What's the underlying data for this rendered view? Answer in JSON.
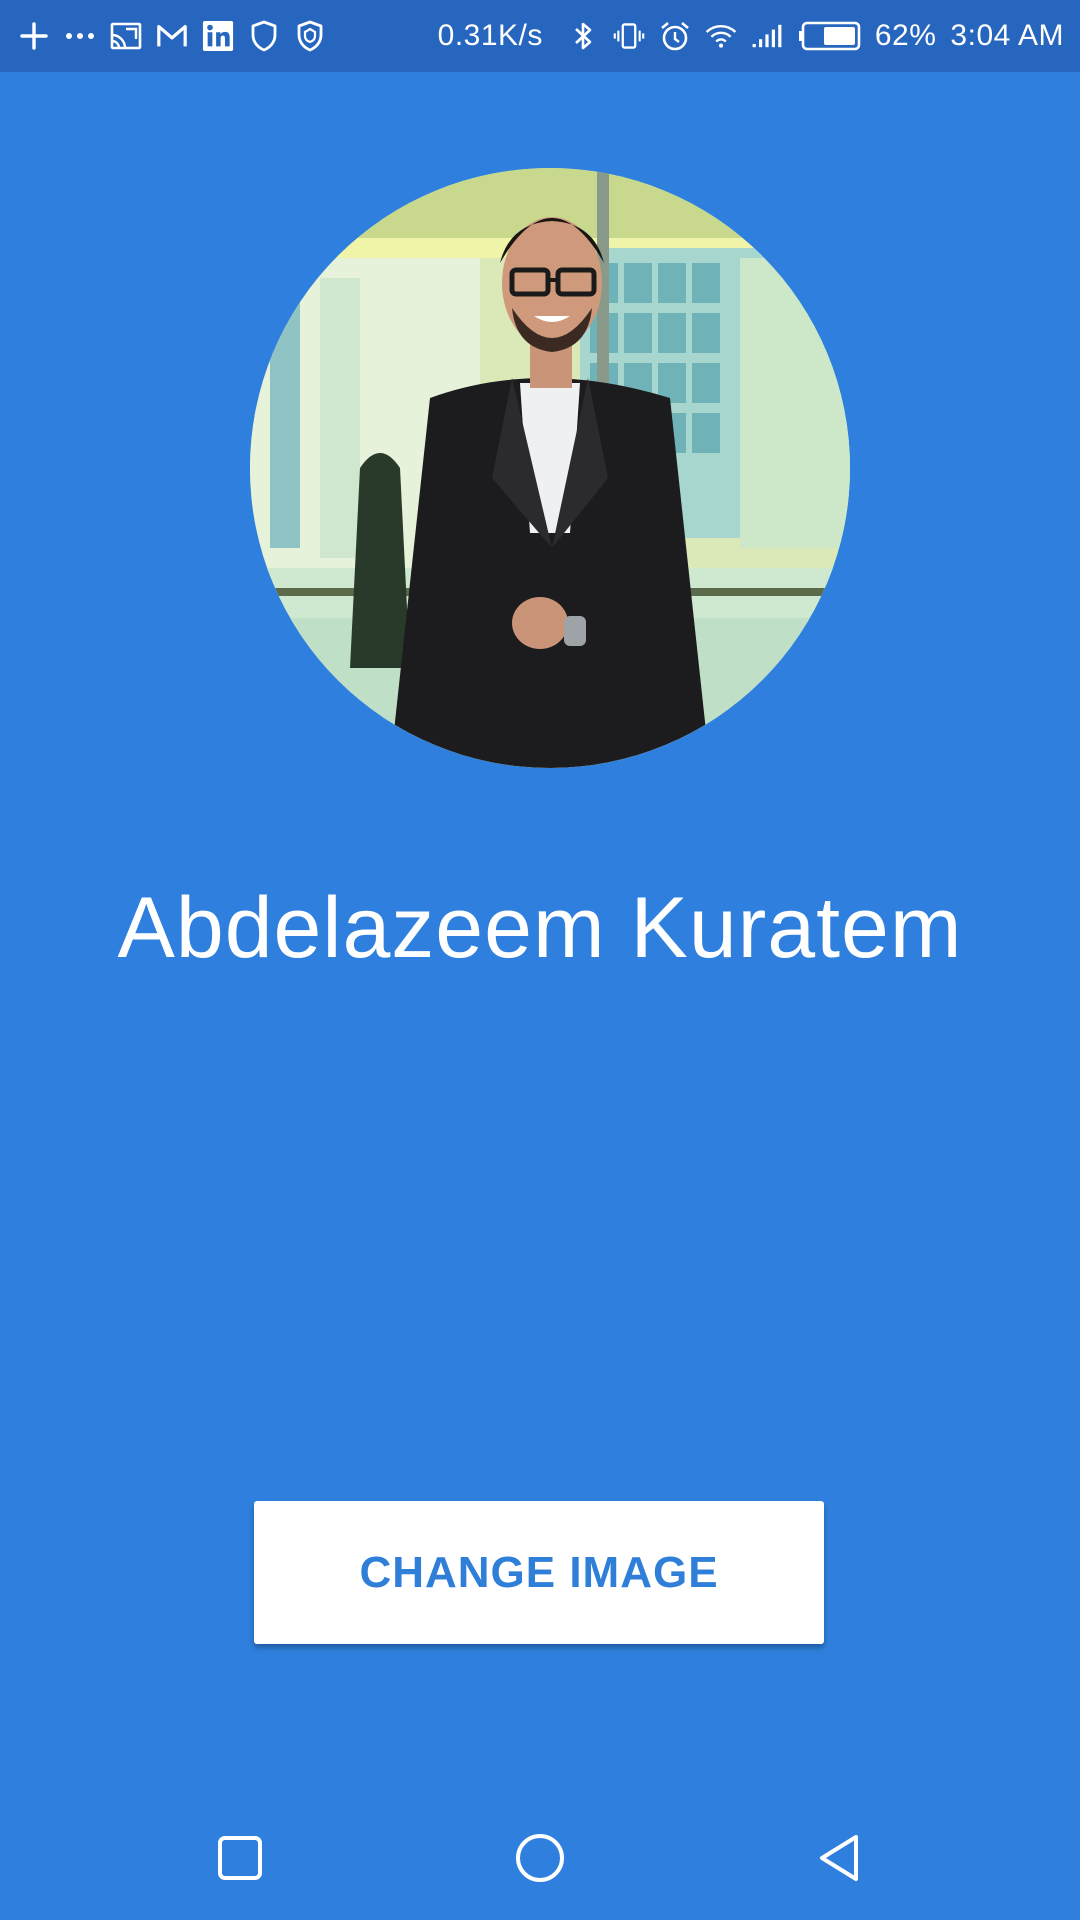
{
  "status_bar": {
    "icons_left": [
      "plus-icon",
      "more-dots-icon",
      "cast-icon",
      "gmail-icon",
      "linkedin-icon",
      "shield-icon",
      "shield-check-icon"
    ],
    "network_speed": "0.31K/s",
    "icons_right": [
      "bluetooth-icon",
      "vibrate-icon",
      "alarm-icon",
      "wifi-icon",
      "signal-icon",
      "battery-icon"
    ],
    "battery_level": 0.62,
    "battery_percent": "62%",
    "time": "3:04 AM"
  },
  "profile": {
    "name": "Abdelazeem Kuratem"
  },
  "actions": {
    "change_image_label": "CHANGE IMAGE"
  },
  "navigation": {
    "icons": [
      "recent-apps-icon",
      "home-icon",
      "back-icon"
    ]
  },
  "colors": {
    "background": "#2f80de",
    "status_bar": "#2766be",
    "button_background": "#ffffff",
    "button_text": "#2f7fd9"
  }
}
